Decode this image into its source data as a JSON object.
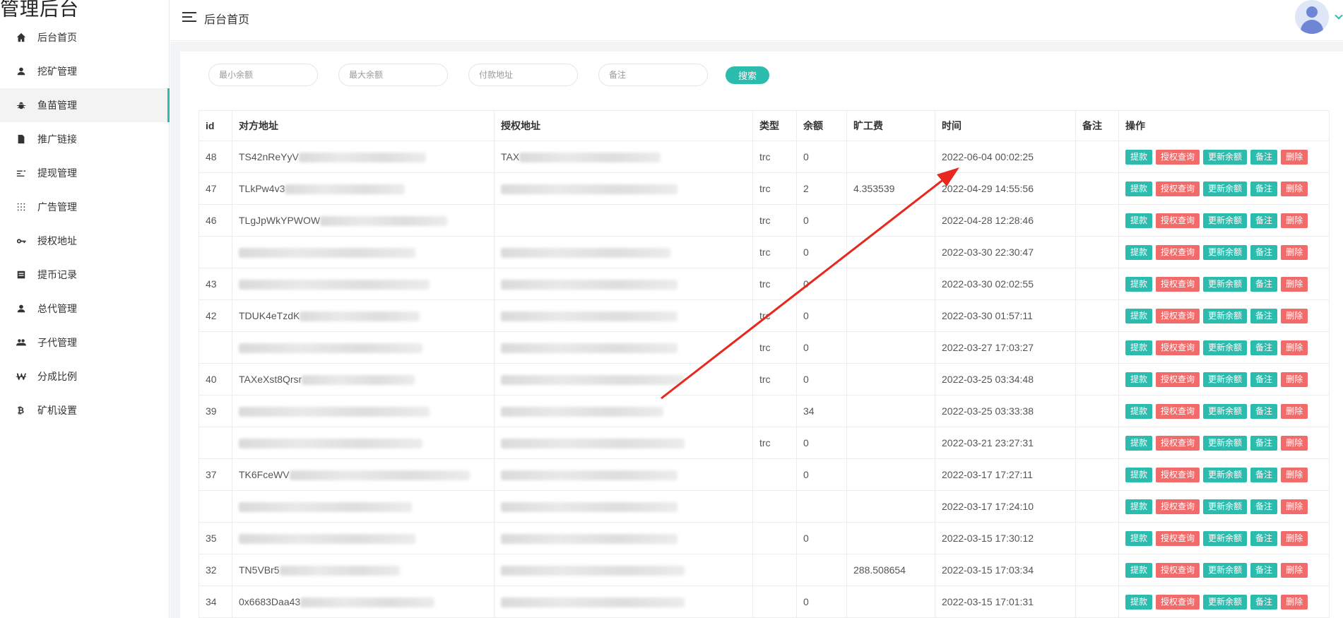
{
  "brand": "管理后台",
  "sidebar": {
    "items": [
      {
        "label": "后台首页",
        "icon": "home-icon"
      },
      {
        "label": "挖矿管理",
        "icon": "user-icon"
      },
      {
        "label": "鱼苗管理",
        "icon": "bug-icon",
        "active": true
      },
      {
        "label": "推广链接",
        "icon": "document-icon"
      },
      {
        "label": "提现管理",
        "icon": "list-icon"
      },
      {
        "label": "广告管理",
        "icon": "grid-dots-icon"
      },
      {
        "label": "授权地址",
        "icon": "key-icon"
      },
      {
        "label": "提币记录",
        "icon": "record-icon"
      },
      {
        "label": "总代管理",
        "icon": "user-icon"
      },
      {
        "label": "子代管理",
        "icon": "users-icon"
      },
      {
        "label": "分成比例",
        "icon": "won-icon"
      },
      {
        "label": "矿机设置",
        "icon": "bitcoin-icon"
      }
    ]
  },
  "header": {
    "title": "后台首页"
  },
  "search": {
    "min_balance_placeholder": "最小余额",
    "max_balance_placeholder": "最大余额",
    "pay_address_placeholder": "付款地址",
    "remark_placeholder": "备注",
    "search_label": "搜索"
  },
  "table": {
    "headers": [
      "id",
      "对方地址",
      "授权地址",
      "类型",
      "余额",
      "旷工费",
      "时间",
      "备注",
      "操作"
    ],
    "actions": [
      "提款",
      "授权查询",
      "更新余额",
      "备注",
      "删除"
    ],
    "rows": [
      {
        "id": "48",
        "from": "TS42nReYyV",
        "auth": "TAX",
        "type": "trc",
        "balance": "0",
        "fee": "",
        "time": "2022-06-04 00:02:25",
        "remark": ""
      },
      {
        "id": "47",
        "from": "TLkPw4v3",
        "auth": "",
        "type": "trc",
        "balance": "2",
        "fee": "4.353539",
        "time": "2022-04-29 14:55:56",
        "remark": ""
      },
      {
        "id": "46",
        "from": "TLgJpWkYPWOW",
        "auth": "",
        "type": "trc",
        "balance": "0",
        "fee": "",
        "time": "2022-04-28 12:28:46",
        "remark": ""
      },
      {
        "id": "",
        "from": "",
        "auth": "",
        "type": "trc",
        "balance": "0",
        "fee": "",
        "time": "2022-03-30 22:30:47",
        "remark": ""
      },
      {
        "id": "43",
        "from": "",
        "auth": "",
        "type": "trc",
        "balance": "0",
        "fee": "",
        "time": "2022-03-30 02:02:55",
        "remark": ""
      },
      {
        "id": "42",
        "from": "TDUK4eTzdK",
        "auth": "",
        "type": "trc",
        "balance": "0",
        "fee": "",
        "time": "2022-03-30 01:57:11",
        "remark": ""
      },
      {
        "id": "",
        "from": "",
        "auth": "",
        "type": "trc",
        "balance": "0",
        "fee": "",
        "time": "2022-03-27 17:03:27",
        "remark": ""
      },
      {
        "id": "40",
        "from": "TAXeXst8Qrsr",
        "auth": "",
        "type": "trc",
        "balance": "0",
        "fee": "",
        "time": "2022-03-25 03:34:48",
        "remark": ""
      },
      {
        "id": "39",
        "from": "",
        "auth": "",
        "type": "",
        "balance": "34",
        "fee": "",
        "time": "2022-03-25 03:33:38",
        "remark": ""
      },
      {
        "id": "",
        "from": "",
        "auth": "",
        "type": "trc",
        "balance": "0",
        "fee": "",
        "time": "2022-03-21 23:27:31",
        "remark": ""
      },
      {
        "id": "37",
        "from": "TK6FceWV",
        "auth": "",
        "type": "",
        "balance": "0",
        "fee": "",
        "time": "2022-03-17 17:27:11",
        "remark": ""
      },
      {
        "id": "",
        "from": "",
        "auth": "",
        "type": "",
        "balance": "",
        "fee": "",
        "time": "2022-03-17 17:24:10",
        "remark": ""
      },
      {
        "id": "35",
        "from": "",
        "auth": "",
        "type": "",
        "balance": "0",
        "fee": "",
        "time": "2022-03-15 17:30:12",
        "remark": ""
      },
      {
        "id": "32",
        "from": "TN5VBr5",
        "auth": "",
        "type": "",
        "balance": "",
        "fee": "288.508654",
        "time": "2022-03-15 17:03:34",
        "remark": ""
      },
      {
        "id": "34",
        "from": "0x6683Daa43",
        "auth": "",
        "type": "",
        "balance": "0",
        "fee": "",
        "time": "2022-03-15 17:01:31",
        "remark": ""
      }
    ]
  },
  "colors": {
    "accent": "#2bbcae",
    "danger": "#f16b6b",
    "annotation": "#e8281e"
  }
}
